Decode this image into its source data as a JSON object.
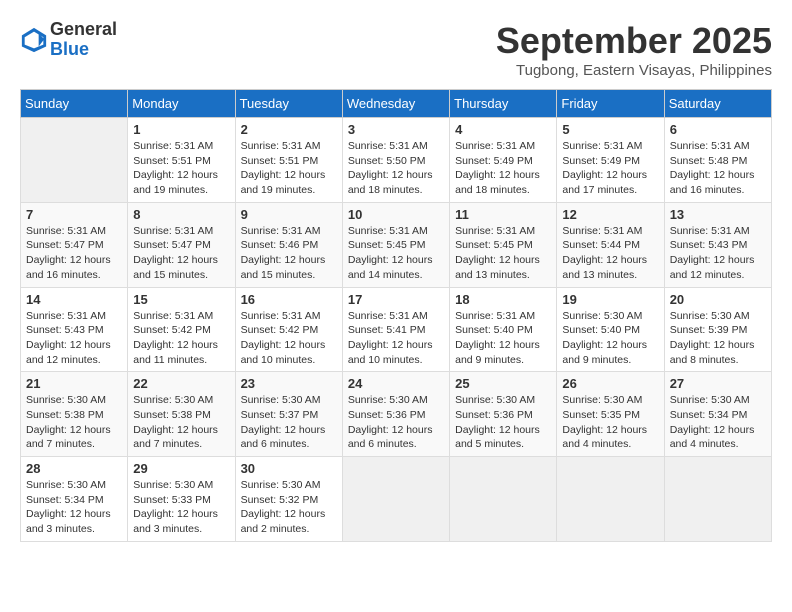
{
  "header": {
    "logo_line1": "General",
    "logo_line2": "Blue",
    "month": "September 2025",
    "location": "Tugbong, Eastern Visayas, Philippines"
  },
  "weekdays": [
    "Sunday",
    "Monday",
    "Tuesday",
    "Wednesday",
    "Thursday",
    "Friday",
    "Saturday"
  ],
  "weeks": [
    [
      {
        "day": "",
        "sunrise": "",
        "sunset": "",
        "daylight": ""
      },
      {
        "day": "1",
        "sunrise": "Sunrise: 5:31 AM",
        "sunset": "Sunset: 5:51 PM",
        "daylight": "Daylight: 12 hours and 19 minutes."
      },
      {
        "day": "2",
        "sunrise": "Sunrise: 5:31 AM",
        "sunset": "Sunset: 5:51 PM",
        "daylight": "Daylight: 12 hours and 19 minutes."
      },
      {
        "day": "3",
        "sunrise": "Sunrise: 5:31 AM",
        "sunset": "Sunset: 5:50 PM",
        "daylight": "Daylight: 12 hours and 18 minutes."
      },
      {
        "day": "4",
        "sunrise": "Sunrise: 5:31 AM",
        "sunset": "Sunset: 5:49 PM",
        "daylight": "Daylight: 12 hours and 18 minutes."
      },
      {
        "day": "5",
        "sunrise": "Sunrise: 5:31 AM",
        "sunset": "Sunset: 5:49 PM",
        "daylight": "Daylight: 12 hours and 17 minutes."
      },
      {
        "day": "6",
        "sunrise": "Sunrise: 5:31 AM",
        "sunset": "Sunset: 5:48 PM",
        "daylight": "Daylight: 12 hours and 16 minutes."
      }
    ],
    [
      {
        "day": "7",
        "sunrise": "Sunrise: 5:31 AM",
        "sunset": "Sunset: 5:47 PM",
        "daylight": "Daylight: 12 hours and 16 minutes."
      },
      {
        "day": "8",
        "sunrise": "Sunrise: 5:31 AM",
        "sunset": "Sunset: 5:47 PM",
        "daylight": "Daylight: 12 hours and 15 minutes."
      },
      {
        "day": "9",
        "sunrise": "Sunrise: 5:31 AM",
        "sunset": "Sunset: 5:46 PM",
        "daylight": "Daylight: 12 hours and 15 minutes."
      },
      {
        "day": "10",
        "sunrise": "Sunrise: 5:31 AM",
        "sunset": "Sunset: 5:45 PM",
        "daylight": "Daylight: 12 hours and 14 minutes."
      },
      {
        "day": "11",
        "sunrise": "Sunrise: 5:31 AM",
        "sunset": "Sunset: 5:45 PM",
        "daylight": "Daylight: 12 hours and 13 minutes."
      },
      {
        "day": "12",
        "sunrise": "Sunrise: 5:31 AM",
        "sunset": "Sunset: 5:44 PM",
        "daylight": "Daylight: 12 hours and 13 minutes."
      },
      {
        "day": "13",
        "sunrise": "Sunrise: 5:31 AM",
        "sunset": "Sunset: 5:43 PM",
        "daylight": "Daylight: 12 hours and 12 minutes."
      }
    ],
    [
      {
        "day": "14",
        "sunrise": "Sunrise: 5:31 AM",
        "sunset": "Sunset: 5:43 PM",
        "daylight": "Daylight: 12 hours and 12 minutes."
      },
      {
        "day": "15",
        "sunrise": "Sunrise: 5:31 AM",
        "sunset": "Sunset: 5:42 PM",
        "daylight": "Daylight: 12 hours and 11 minutes."
      },
      {
        "day": "16",
        "sunrise": "Sunrise: 5:31 AM",
        "sunset": "Sunset: 5:42 PM",
        "daylight": "Daylight: 12 hours and 10 minutes."
      },
      {
        "day": "17",
        "sunrise": "Sunrise: 5:31 AM",
        "sunset": "Sunset: 5:41 PM",
        "daylight": "Daylight: 12 hours and 10 minutes."
      },
      {
        "day": "18",
        "sunrise": "Sunrise: 5:31 AM",
        "sunset": "Sunset: 5:40 PM",
        "daylight": "Daylight: 12 hours and 9 minutes."
      },
      {
        "day": "19",
        "sunrise": "Sunrise: 5:30 AM",
        "sunset": "Sunset: 5:40 PM",
        "daylight": "Daylight: 12 hours and 9 minutes."
      },
      {
        "day": "20",
        "sunrise": "Sunrise: 5:30 AM",
        "sunset": "Sunset: 5:39 PM",
        "daylight": "Daylight: 12 hours and 8 minutes."
      }
    ],
    [
      {
        "day": "21",
        "sunrise": "Sunrise: 5:30 AM",
        "sunset": "Sunset: 5:38 PM",
        "daylight": "Daylight: 12 hours and 7 minutes."
      },
      {
        "day": "22",
        "sunrise": "Sunrise: 5:30 AM",
        "sunset": "Sunset: 5:38 PM",
        "daylight": "Daylight: 12 hours and 7 minutes."
      },
      {
        "day": "23",
        "sunrise": "Sunrise: 5:30 AM",
        "sunset": "Sunset: 5:37 PM",
        "daylight": "Daylight: 12 hours and 6 minutes."
      },
      {
        "day": "24",
        "sunrise": "Sunrise: 5:30 AM",
        "sunset": "Sunset: 5:36 PM",
        "daylight": "Daylight: 12 hours and 6 minutes."
      },
      {
        "day": "25",
        "sunrise": "Sunrise: 5:30 AM",
        "sunset": "Sunset: 5:36 PM",
        "daylight": "Daylight: 12 hours and 5 minutes."
      },
      {
        "day": "26",
        "sunrise": "Sunrise: 5:30 AM",
        "sunset": "Sunset: 5:35 PM",
        "daylight": "Daylight: 12 hours and 4 minutes."
      },
      {
        "day": "27",
        "sunrise": "Sunrise: 5:30 AM",
        "sunset": "Sunset: 5:34 PM",
        "daylight": "Daylight: 12 hours and 4 minutes."
      }
    ],
    [
      {
        "day": "28",
        "sunrise": "Sunrise: 5:30 AM",
        "sunset": "Sunset: 5:34 PM",
        "daylight": "Daylight: 12 hours and 3 minutes."
      },
      {
        "day": "29",
        "sunrise": "Sunrise: 5:30 AM",
        "sunset": "Sunset: 5:33 PM",
        "daylight": "Daylight: 12 hours and 3 minutes."
      },
      {
        "day": "30",
        "sunrise": "Sunrise: 5:30 AM",
        "sunset": "Sunset: 5:32 PM",
        "daylight": "Daylight: 12 hours and 2 minutes."
      },
      {
        "day": "",
        "sunrise": "",
        "sunset": "",
        "daylight": ""
      },
      {
        "day": "",
        "sunrise": "",
        "sunset": "",
        "daylight": ""
      },
      {
        "day": "",
        "sunrise": "",
        "sunset": "",
        "daylight": ""
      },
      {
        "day": "",
        "sunrise": "",
        "sunset": "",
        "daylight": ""
      }
    ]
  ]
}
